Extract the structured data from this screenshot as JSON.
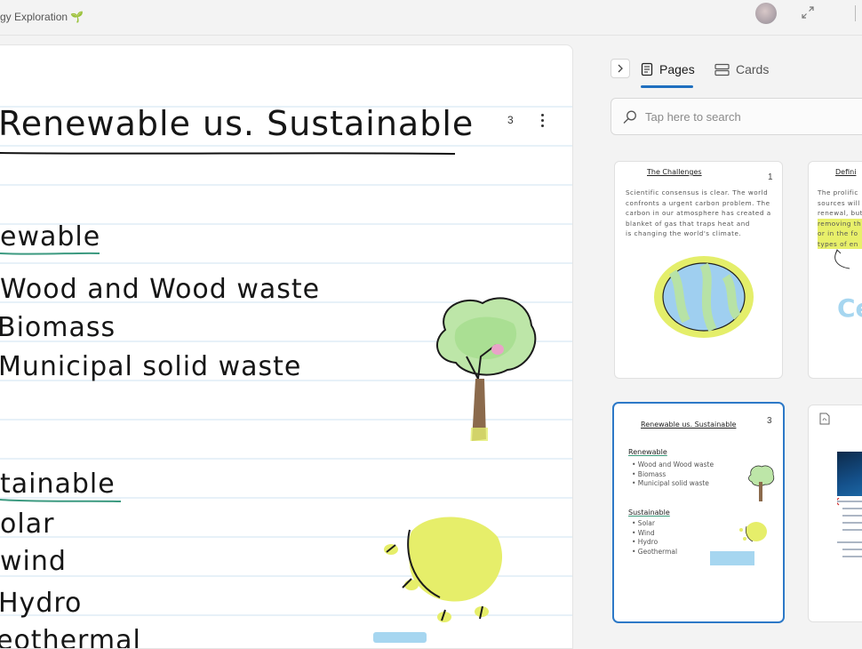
{
  "titlebar": {
    "title": "gy Exploration 🌱"
  },
  "canvas": {
    "page_number": "3",
    "heading": "Renewable us. Sustainable",
    "renewable_heading": "ewable",
    "renewable_items": [
      "Wood and Wood waste",
      "Biomass",
      "Municipal solid waste"
    ],
    "sustainable_heading": "tainable",
    "sustainable_items": [
      "olar",
      "wind",
      "Hydro",
      "eothermal"
    ]
  },
  "panel": {
    "tabs": [
      {
        "label": "Pages",
        "icon": "pages-icon",
        "active": true
      },
      {
        "label": "Cards",
        "icon": "cards-icon",
        "active": false
      }
    ],
    "search_placeholder": "Tap here to search",
    "accent": "#1f6fbf",
    "thumbnails": [
      {
        "title": "The Challenges",
        "number": "1",
        "body": [
          "Scientific consensus is clear. The world",
          "confronts a urgent carbon problem. The",
          "carbon in our atmosphere has created a",
          "blanket of gas that traps heat and",
          "is changing the world's climate."
        ]
      },
      {
        "title": "Defini",
        "body": [
          "The prolific",
          "sources will",
          "renewal, but",
          "removing th",
          "or in the fo",
          "types of en"
        ],
        "big_text": "Ce"
      },
      {
        "title": "Renewable us. Sustainable",
        "number": "3",
        "renewable_heading": "Renewable",
        "renewable_items": [
          "• Wood and Wood waste",
          "• Biomass",
          "• Municipal solid waste"
        ],
        "sustainable_heading": "Sustainable",
        "sustainable_items": [
          "• Solar",
          "• Wind",
          "• Hydro",
          "• Geothermal"
        ]
      },
      {
        "title": ""
      }
    ]
  }
}
